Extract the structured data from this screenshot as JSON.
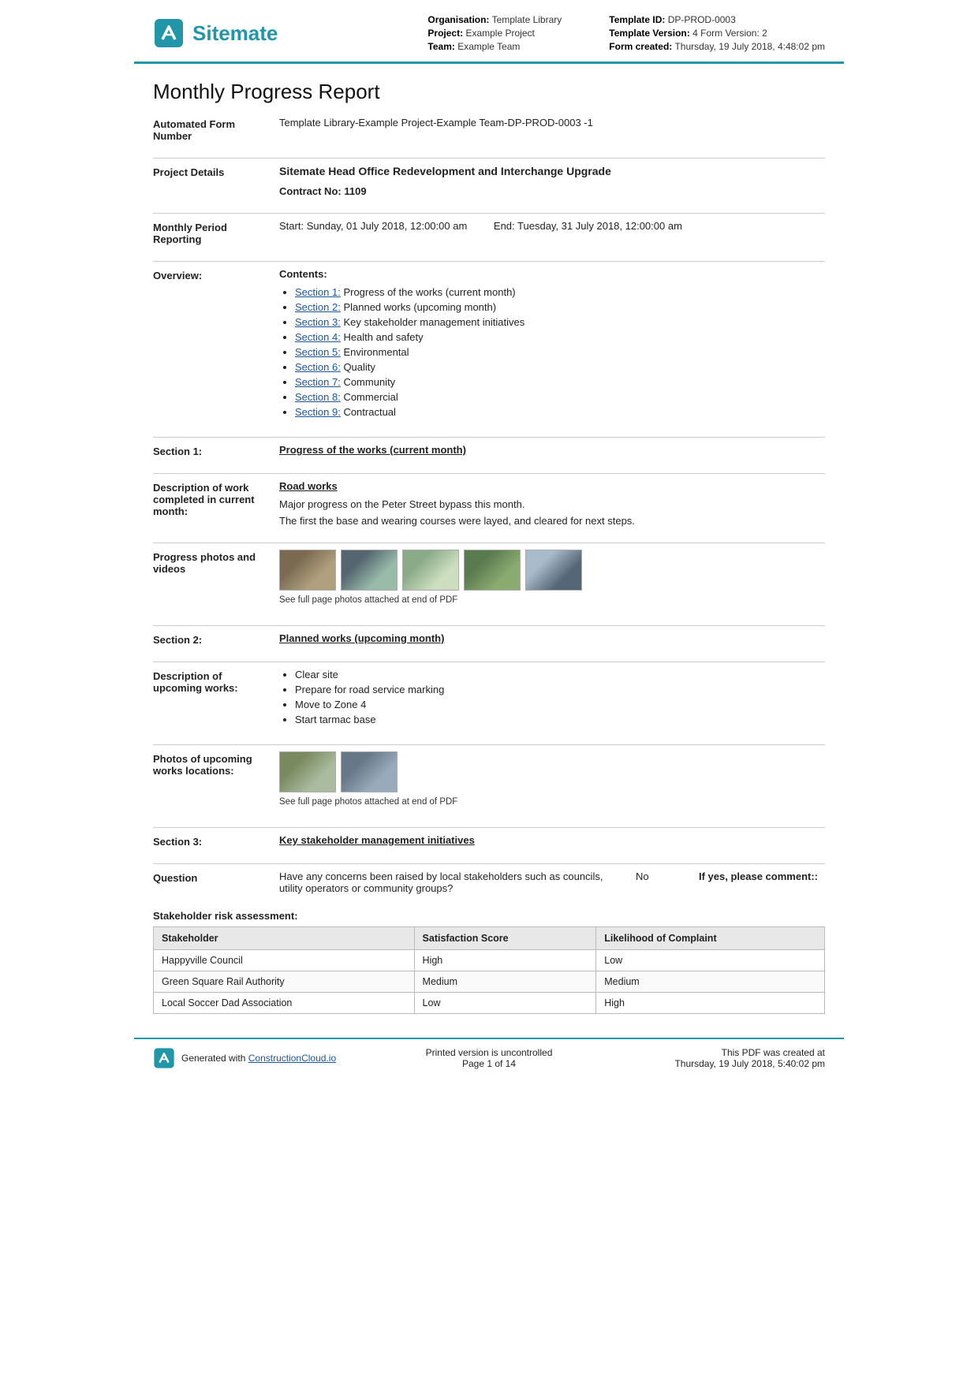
{
  "header": {
    "logo_text": "Sitemate",
    "org_label": "Organisation:",
    "org_value": "Template Library",
    "project_label": "Project:",
    "project_value": "Example Project",
    "team_label": "Team:",
    "team_value": "Example Team",
    "template_id_label": "Template ID:",
    "template_id_value": "DP-PROD-0003",
    "template_version_label": "Template Version:",
    "template_version_value": "4 Form Version: 2",
    "form_created_label": "Form created:",
    "form_created_value": "Thursday, 19 July 2018, 4:48:02 pm"
  },
  "report": {
    "title": "Monthly Progress Report",
    "automated_form_label": "Automated Form Number",
    "automated_form_value": "Template Library-Example Project-Example Team-DP-PROD-0003  -1",
    "project_details_label": "Project Details",
    "project_details_value": "Sitemate Head Office Redevelopment and Interchange Upgrade",
    "contract_no_label": "Contract No:",
    "contract_no_value": "1109"
  },
  "monthly_period": {
    "label": "Monthly Period Reporting",
    "start_label": "Start:",
    "start_value": "Sunday, 01 July 2018, 12:00:00 am",
    "end_label": "End:",
    "end_value": "Tuesday, 31 July 2018, 12:00:00 am"
  },
  "overview": {
    "label": "Overview:",
    "contents_label": "Contents:",
    "sections": [
      {
        "id": "Section 1",
        "title": "Progress of the works (current month)"
      },
      {
        "id": "Section 2",
        "title": "Planned works (upcoming month)"
      },
      {
        "id": "Section 3",
        "title": "Key stakeholder management initiatives"
      },
      {
        "id": "Section 4",
        "title": "Health and safety"
      },
      {
        "id": "Section 5",
        "title": "Environmental"
      },
      {
        "id": "Section 6",
        "title": "Quality"
      },
      {
        "id": "Section 7",
        "title": "Community"
      },
      {
        "id": "Section 8",
        "title": "Commercial"
      },
      {
        "id": "Section 9",
        "title": "Contractual"
      }
    ]
  },
  "section1": {
    "label": "Section 1:",
    "title": "Progress of the works (current month)",
    "description_label": "Description of work completed in current month:",
    "work_type": "Road works",
    "desc_line1": "Major progress on the Peter Street bypass this month.",
    "desc_line2": "The first the base and wearing courses were layed, and cleared for next steps.",
    "photos_label": "Progress photos and videos",
    "photos_note": "See full page photos attached at end of PDF"
  },
  "section2": {
    "label": "Section 2:",
    "title": "Planned works (upcoming month)",
    "description_label": "Description of upcoming works:",
    "works": [
      "Clear site",
      "Prepare for road service marking",
      "Move to Zone 4",
      "Start tarmac base"
    ],
    "photos_label": "Photos of upcoming works locations:",
    "photos_note": "See full page photos attached at end of PDF"
  },
  "section3": {
    "label": "Section 3:",
    "title": "Key stakeholder management initiatives",
    "question_label": "Question",
    "question_text": "Have any concerns been raised by local stakeholders such as councils, utility operators or community groups?",
    "question_answer": "No",
    "question_comment_label": "If yes, please comment::",
    "stakeholder_table_label": "Stakeholder risk assessment:",
    "table_headers": [
      "Stakeholder",
      "Satisfaction Score",
      "Likelihood of Complaint"
    ],
    "table_rows": [
      [
        "Happyville Council",
        "High",
        "Low"
      ],
      [
        "Green Square Rail Authority",
        "Medium",
        "Medium"
      ],
      [
        "Local Soccer Dad Association",
        "Low",
        "High"
      ]
    ]
  },
  "footer": {
    "generated_text": "Generated with",
    "link_text": "ConstructionCloud.io",
    "center_line1": "Printed version is uncontrolled",
    "center_line2": "Page 1 of 14",
    "right_line1": "This PDF was created at",
    "right_line2": "Thursday, 19 July 2018, 5:40:02 pm"
  }
}
